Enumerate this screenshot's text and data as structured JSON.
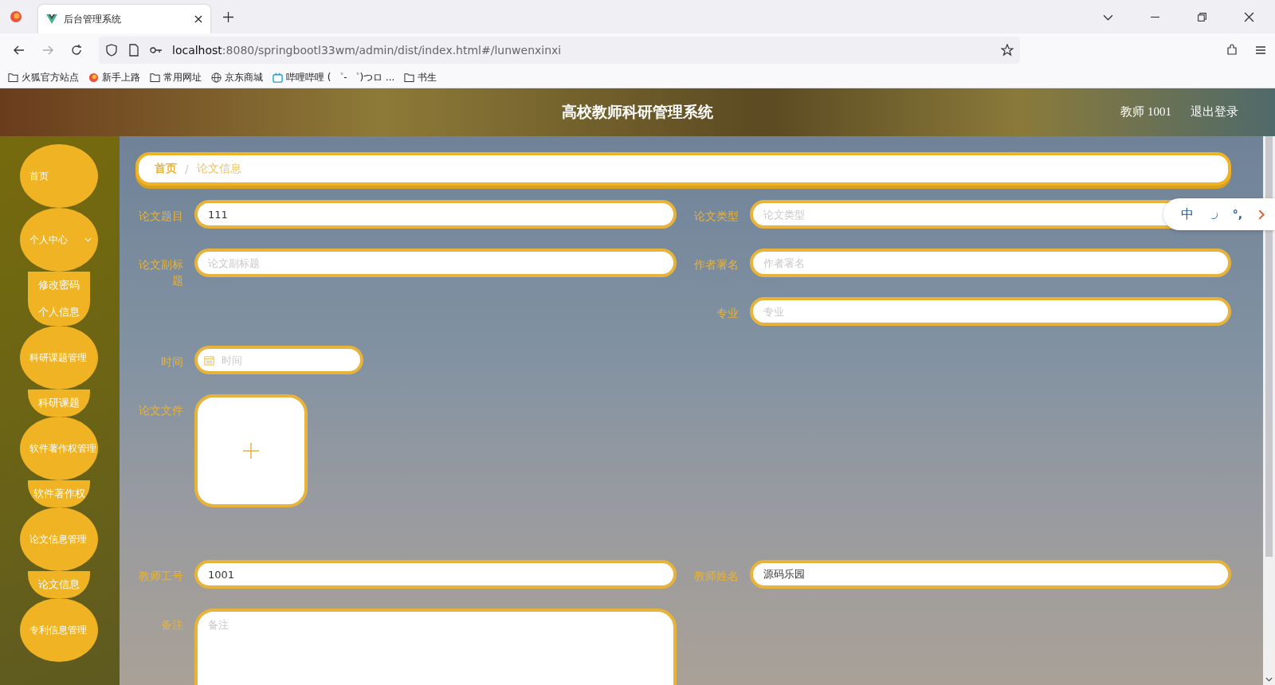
{
  "browser": {
    "tabs": [
      {
        "title": "后台管理系统",
        "selected": true
      }
    ],
    "url": {
      "host": "localhost",
      "path": ":8080/springbootl33wm/admin/dist/index.html#/lunwenxinxi"
    },
    "bookmarks": [
      {
        "label": "火狐官方站点",
        "kind": "folder"
      },
      {
        "label": "新手上路",
        "kind": "firefox"
      },
      {
        "label": "常用网址",
        "kind": "folder"
      },
      {
        "label": "京东商城",
        "kind": "globe"
      },
      {
        "label": "哔哩哔哩 ( ゜- ゜)つロ ...",
        "kind": "tv"
      },
      {
        "label": "书生",
        "kind": "folder"
      }
    ]
  },
  "header": {
    "title": "高校教师科研管理系统",
    "user": "教师 1001",
    "logout": "退出登录"
  },
  "sidebar": {
    "items": [
      {
        "label": "首页"
      },
      {
        "label": "个人中心",
        "caret": true,
        "children": [
          {
            "label": "修改密码"
          },
          {
            "label": "个人信息"
          }
        ]
      },
      {
        "label": "科研课题管理",
        "children": [
          {
            "label": "科研课题"
          }
        ]
      },
      {
        "label": "软件著作权管理",
        "children": [
          {
            "label": "软件著作权"
          }
        ]
      },
      {
        "label": "论文信息管理",
        "children": [
          {
            "label": "论文信息"
          }
        ]
      },
      {
        "label": "专利信息管理"
      }
    ]
  },
  "breadcrumb": [
    {
      "label": "首页",
      "selected": false
    },
    {
      "label": "论文信息",
      "selected": true
    }
  ],
  "breadcrumb_separator": "/",
  "form": {
    "rows": [
      {
        "left": {
          "label": "论文题目",
          "kind": "text",
          "value": "111"
        },
        "right": {
          "label": "论文类型",
          "kind": "text",
          "placeholder": "论文类型"
        }
      },
      {
        "left": {
          "label": "论文副标题",
          "kind": "text",
          "placeholder": "论文副标题"
        },
        "right": {
          "label": "作者署名",
          "kind": "text",
          "placeholder": "作者署名"
        }
      },
      {
        "right": {
          "label": "专业",
          "kind": "text",
          "placeholder": "专业"
        }
      },
      {
        "left": {
          "label": "时间",
          "kind": "date",
          "placeholder": "时间"
        }
      },
      {
        "left": {
          "label": "论文文件",
          "kind": "upload"
        }
      },
      {
        "left": {
          "label": "教师工号",
          "kind": "text",
          "value": "1001"
        },
        "right": {
          "label": "教师姓名",
          "kind": "text",
          "value": "源码乐园"
        }
      },
      {
        "left": {
          "label": "备注",
          "kind": "textarea",
          "placeholder": "备注"
        }
      }
    ]
  },
  "ime": {
    "language": "中",
    "punctuation": "°,"
  }
}
